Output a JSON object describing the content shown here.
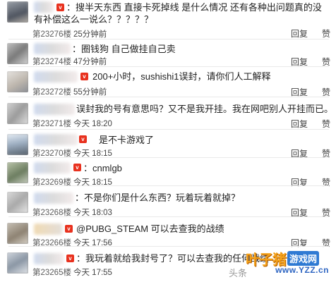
{
  "actions": {
    "reply": "回复",
    "like": "赞"
  },
  "comments": [
    {
      "text": "：搜半天东西 直接卡死掉线 是什么情况 还有各种出问题真的没有补偿这么一说么？？？？？",
      "floor": "第23276楼",
      "time": "25分钟前",
      "vip": true
    },
    {
      "text": "：圈钱狗 自己做挂自己卖",
      "floor": "第23274楼",
      "time": "47分钟前",
      "vip": false
    },
    {
      "text": "200+小时，sushishi1误封，请你们人工解释",
      "floor": "第23272楼",
      "time": "55分钟前",
      "vip": true
    },
    {
      "text": "误封我的号有意思吗？又不是我开挂。我在网吧别人开挂而已。",
      "floor": "第23271楼",
      "time": "今天 18:20",
      "vip": false
    },
    {
      "text": "是不卡游戏了",
      "floor": "第23270楼",
      "time": "今天 18:15",
      "vip": true
    },
    {
      "text": "：cnmlgb",
      "floor": "第23269楼",
      "time": "今天 18:15",
      "vip": true
    },
    {
      "text": "：不是你们是什么东西？玩着玩着就掉？",
      "floor": "第23268楼",
      "time": "今天 18:03",
      "vip": false
    },
    {
      "text": "@PUBG_STEAM   可以去查我的战绩",
      "floor": "第23266楼",
      "time": "今天 17:56",
      "vip": true
    },
    {
      "text": "：我玩着就给我封号了？可以去查我的任何战绩",
      "floor": "第23265楼",
      "time": "今天 17:55",
      "vip": true
    }
  ],
  "watermark": {
    "logo": "叶子猪",
    "game": "游戏网",
    "url": "www.YZZ.cn",
    "author": "头条"
  },
  "colors": {
    "background": "#ffffff",
    "text": "#222222",
    "meta": "#5d5d5d",
    "divider": "#e9e9e9",
    "vip_badge": "#e8311e",
    "watermark_orange": "#f4a21b",
    "watermark_blue": "#2f7ad3"
  }
}
